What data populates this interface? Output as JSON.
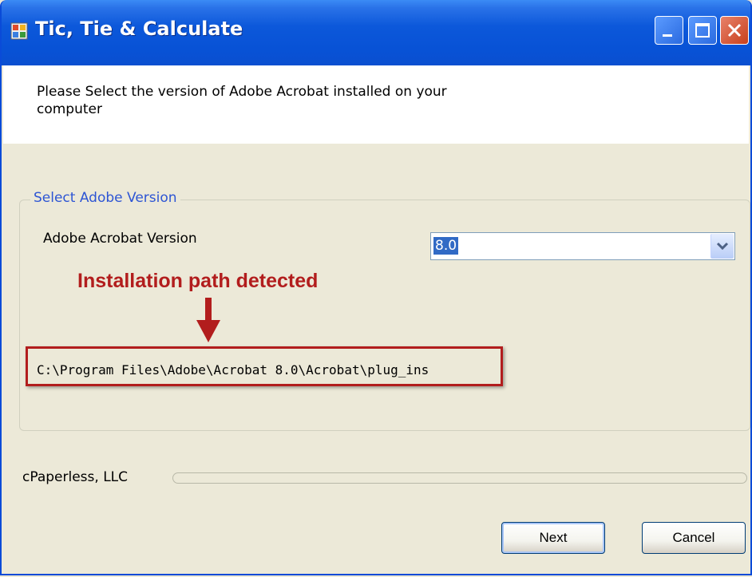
{
  "window": {
    "title": "Tic, Tie & Calculate",
    "icons": {
      "app": "app-window-icon",
      "minimize": "minimize-icon",
      "maximize": "maximize-icon",
      "close": "close-icon"
    }
  },
  "banner": {
    "instruction": "Please Select the version of Adobe Acrobat installed on your\n computer"
  },
  "group": {
    "legend": "Select Adobe Version",
    "version_label": "Adobe Acrobat Version",
    "version_value": "8.0",
    "version_dropdown_icon": "chevron-down-icon"
  },
  "annotation": {
    "title": "Installation path detected",
    "arrow_icon": "arrow-down-icon",
    "path": "C:\\Program Files\\Adobe\\Acrobat 8.0\\Acrobat\\plug_ins",
    "color": "#b21d1d"
  },
  "footer": {
    "company": "cPaperless, LLC",
    "next_label": "Next",
    "cancel_label": "Cancel"
  },
  "colors": {
    "titlebar": "#0852d6",
    "window_bg": "#ece9d8",
    "legend_text": "#2d55d4",
    "selection": "#316ac5"
  }
}
